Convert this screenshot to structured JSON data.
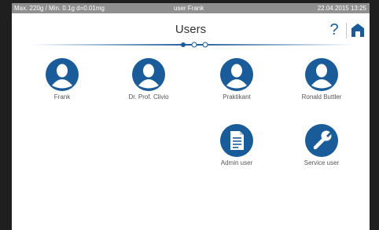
{
  "status": {
    "capacity": "Max. 220g / Min. 0.1g  d=0.01mg",
    "user": "user Frank",
    "datetime": "22.04.2015  13:25"
  },
  "header": {
    "title": "Users",
    "help_label": "?"
  },
  "pager": {
    "page_count": 3,
    "current_page": 1
  },
  "users": [
    {
      "label": "Frank",
      "icon": "person-icon"
    },
    {
      "label": "Dr. Prof. Clivio",
      "icon": "person-icon"
    },
    {
      "label": "Praktikant",
      "icon": "person-icon"
    },
    {
      "label": "Ronald Buttler",
      "icon": "person-icon"
    },
    {
      "label": "Admin user",
      "icon": "document-icon"
    },
    {
      "label": "Service user",
      "icon": "wrench-icon"
    }
  ],
  "colors": {
    "accent": "#1a5c9a",
    "status_bar": "#8f8f8f",
    "bezel": "#1f1f1f"
  }
}
